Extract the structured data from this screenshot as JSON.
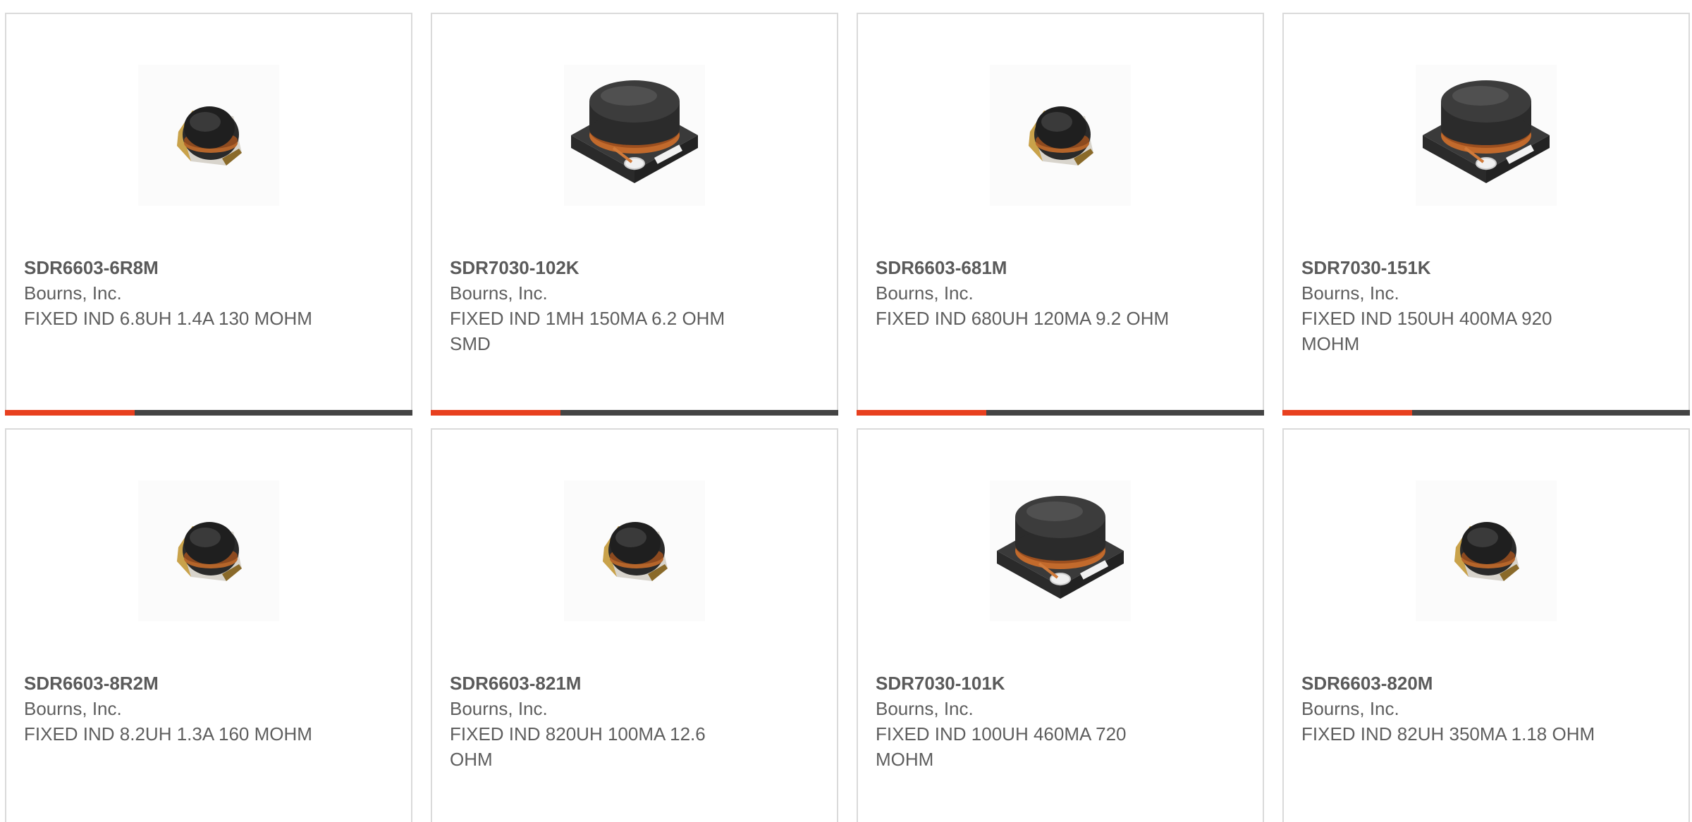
{
  "products": [
    {
      "part": "SDR6603-6R8M",
      "manufacturer": "Bourns, Inc.",
      "description": "FIXED IND 6.8UH 1.4A 130 MOHM",
      "image": "sdr6603-inductor"
    },
    {
      "part": "SDR7030-102K",
      "manufacturer": "Bourns, Inc.",
      "description": "FIXED IND 1MH 150MA 6.2 OHM SMD",
      "image": "sdr7030-inductor"
    },
    {
      "part": "SDR6603-681M",
      "manufacturer": "Bourns, Inc.",
      "description": "FIXED IND 680UH 120MA 9.2 OHM",
      "image": "sdr6603-inductor"
    },
    {
      "part": "SDR7030-151K",
      "manufacturer": "Bourns, Inc.",
      "description": "FIXED IND 150UH 400MA 920 MOHM",
      "image": "sdr7030-inductor"
    },
    {
      "part": "SDR6603-8R2M",
      "manufacturer": "Bourns, Inc.",
      "description": "FIXED IND 8.2UH 1.3A 160 MOHM",
      "image": "sdr6603-inductor"
    },
    {
      "part": "SDR6603-821M",
      "manufacturer": "Bourns, Inc.",
      "description": "FIXED IND 820UH 100MA 12.6 OHM",
      "image": "sdr6603-inductor"
    },
    {
      "part": "SDR7030-101K",
      "manufacturer": "Bourns, Inc.",
      "description": "FIXED IND 100UH 460MA 720 MOHM",
      "image": "sdr7030-inductor"
    },
    {
      "part": "SDR6603-820M",
      "manufacturer": "Bourns, Inc.",
      "description": "FIXED IND 82UH 350MA 1.18 OHM",
      "image": "sdr6603-inductor"
    }
  ],
  "colors": {
    "accent": "#e8401f",
    "bar": "#444444",
    "border": "#dadada",
    "text": "#5e5e5e"
  }
}
